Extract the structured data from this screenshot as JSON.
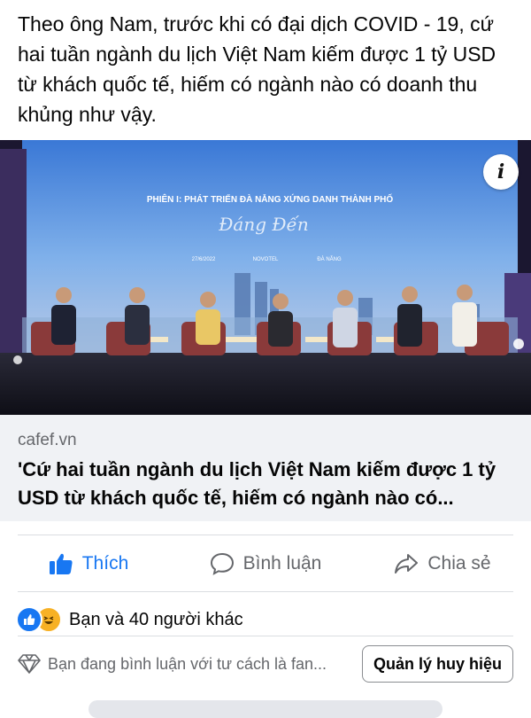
{
  "post": {
    "text": "Theo ông Nam, trước khi có đại dịch COVID - 19, cứ hai tuần ngành du lịch Việt Nam kiếm được 1 tỷ USD từ khách quốc tế, hiếm có ngành nào có doanh thu khủng như vậy."
  },
  "link_preview": {
    "banner_title": "PHIÊN I: PHÁT TRIỂN ĐÀ NẴNG XỨNG DANH THÀNH PHỐ",
    "banner_script": "Đáng Đến",
    "banner_date": "27/6/2022",
    "banner_venue": "NOVOTEL",
    "banner_city": "ĐÀ NẴNG",
    "info_label": "i",
    "domain": "cafef.vn",
    "title": "'Cứ hai tuần ngành du lịch Việt Nam kiếm được 1 tỷ USD từ khách quốc tế, hiếm có ngành nào có..."
  },
  "actions": {
    "like": "Thích",
    "comment": "Bình luận",
    "share": "Chia sẻ"
  },
  "reactions": {
    "summary": "Bạn và 40 người khác",
    "types": [
      "like-icon",
      "haha-icon"
    ]
  },
  "comment_bar": {
    "hint": "Bạn đang bình luận với tư cách là fan...",
    "badge_button": "Quản lý huy hiệu"
  },
  "colors": {
    "accent": "#1877f2",
    "secondary_text": "#65676b",
    "meta_bg": "#f0f2f5"
  }
}
